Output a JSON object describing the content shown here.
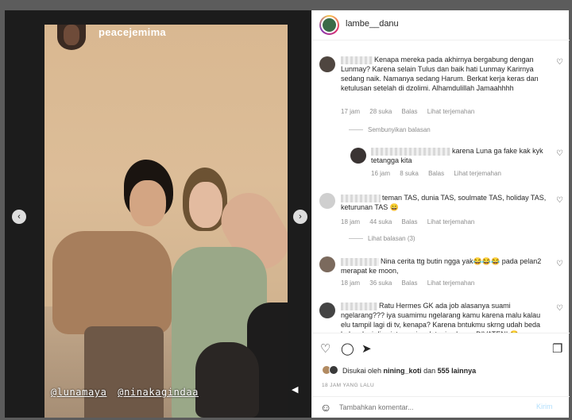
{
  "story": {
    "username": "peacejemima",
    "tags": [
      "@lunamaya",
      "@ninakagindaa"
    ]
  },
  "icons": {
    "prev": "chevron-left-icon",
    "next": "chevron-right-icon",
    "volume": "volume-icon",
    "more": "more-options-icon",
    "heart": "heart-icon",
    "comment": "comment-icon",
    "share": "share-icon",
    "save": "bookmark-icon",
    "emoji": "emoji-icon"
  },
  "header": {
    "username": "lambe__danu"
  },
  "comments": [
    {
      "text": "Kenapa mereka pada akhirnya bergabung dengan Lunmay? Karena selain Tulus dan baik hati Lunmay Karirnya sedang naik. Namanya sedang Harum. Berkat kerja keras dan ketulusan setelah di dzolimi. Alhamdulillah Jamaahhhh",
      "time": "17 jam",
      "likes": "28 suka",
      "reply": "Balas",
      "translate": "Lihat terjemahan"
    },
    {
      "toggle": "Sembunyikan balasan"
    },
    {
      "text": "karena Luna ga fake kak kyk tetangga kita",
      "time": "16 jam",
      "likes": "8 suka",
      "reply": "Balas",
      "translate": "Lihat terjemahan"
    },
    {
      "text": "teman TAS, dunia TAS, soulmate TAS, holiday TAS, keturunan TAS 😄",
      "time": "18 jam",
      "likes": "44 suka",
      "reply": "Balas",
      "translate": "Lihat terjemahan"
    },
    {
      "toggle": "Lihat balasan (3)"
    },
    {
      "text": "Nina cerita ttg butin ngga yak😂😂😂 pada pelan2 merapat ke moon,",
      "time": "18 jam",
      "likes": "36 suka",
      "reply": "Balas",
      "translate": "Lihat terjemahan"
    },
    {
      "text": "Ratu Hermes GK ada job alasanya suami ngelarang??? iya suamimu ngelarang kamu karena malu kalau elu tampil lagi di tv, kenapa? Karena bntukmu skrng udah beda bukan lagi diva internasional, tapi sekrang DIVATENI 😂"
    }
  ],
  "likes": {
    "prefix": "Disukai oleh",
    "user": "nining_koti",
    "connector": "dan",
    "others": "555 lainnya"
  },
  "timestamp": "18 JAM YANG LALU",
  "add_comment": {
    "placeholder": "Tambahkan komentar...",
    "post_label": "Kirim"
  }
}
